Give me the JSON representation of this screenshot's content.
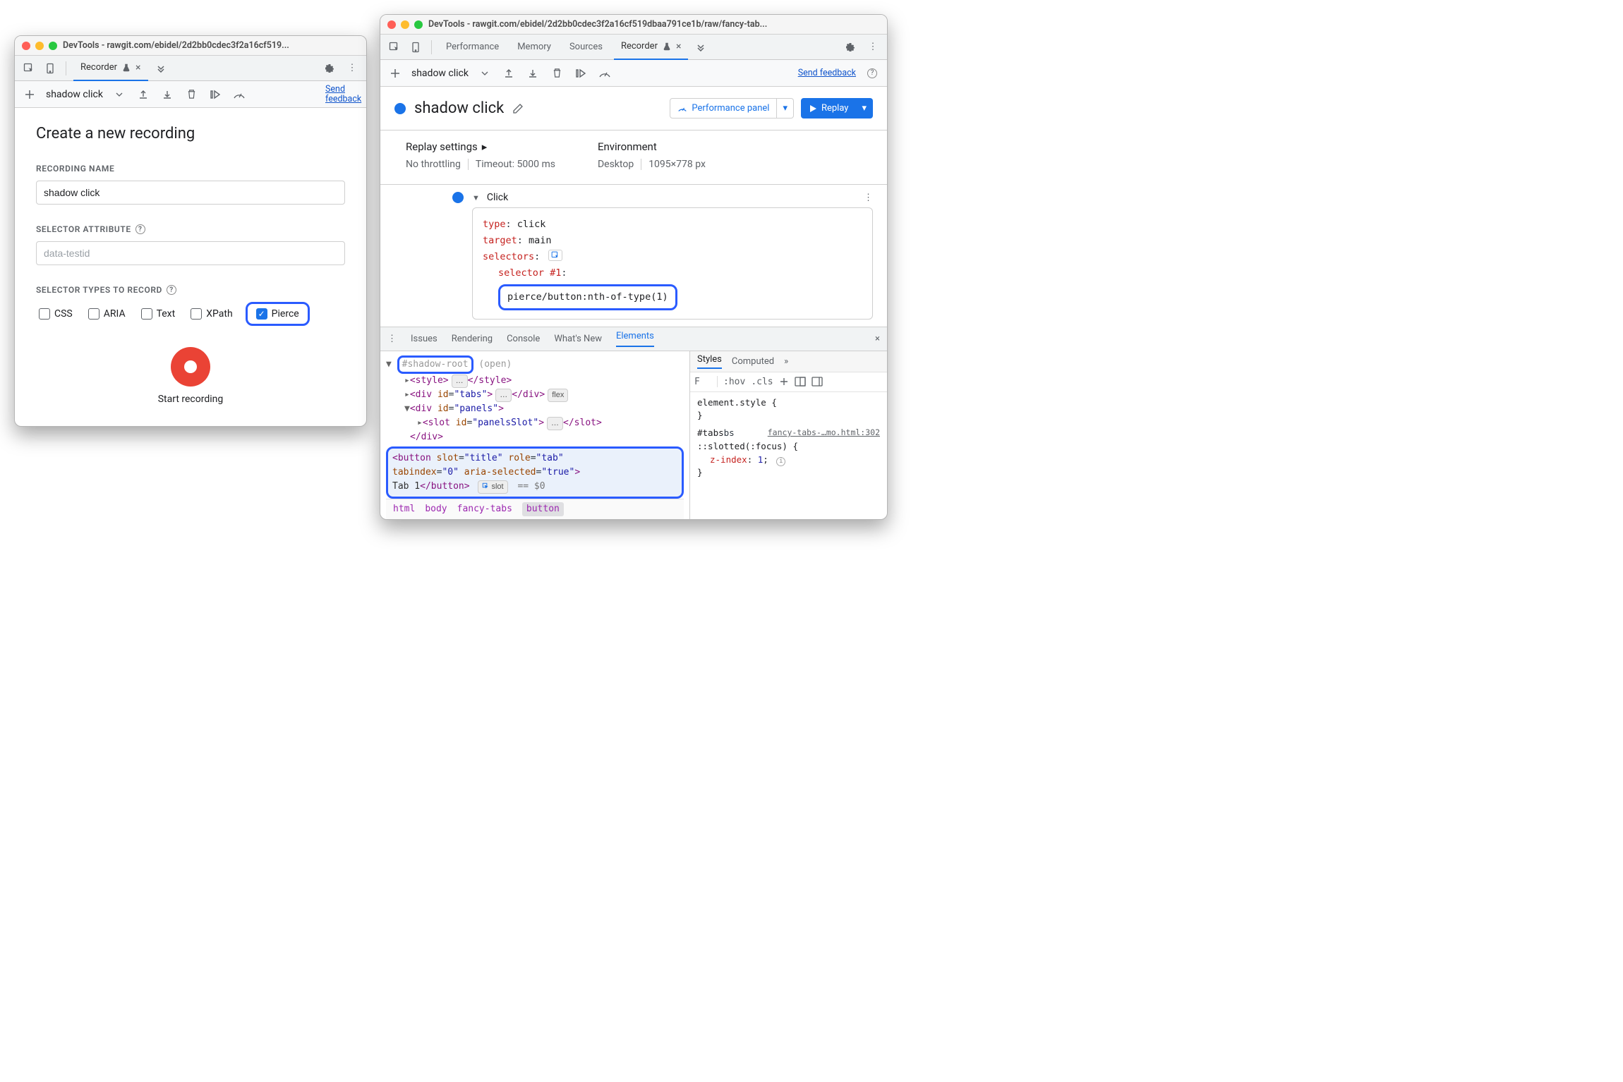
{
  "left": {
    "title": "DevTools - rawgit.com/ebidel/2d2bb0cdec3f2a16cf519...",
    "tab": "Recorder",
    "toolbar": {
      "name": "shadow click",
      "send_feedback": "Send feedback"
    },
    "heading": "Create a new recording",
    "recording_name_label": "RECORDING NAME",
    "recording_name_value": "shadow click",
    "selector_attr_label": "SELECTOR ATTRIBUTE",
    "selector_attr_placeholder": "data-testid",
    "selector_types_label": "SELECTOR TYPES TO RECORD",
    "types": {
      "css": "CSS",
      "aria": "ARIA",
      "text": "Text",
      "xpath": "XPath",
      "pierce": "Pierce"
    },
    "start_label": "Start recording"
  },
  "right": {
    "title": "DevTools - rawgit.com/ebidel/2d2bb0cdec3f2a16cf519dbaa791ce1b/raw/fancy-tab...",
    "tabs": {
      "performance": "Performance",
      "memory": "Memory",
      "sources": "Sources",
      "recorder": "Recorder"
    },
    "toolbar": {
      "name": "shadow click",
      "send_feedback": "Send feedback"
    },
    "header": {
      "title": "shadow click",
      "perf_panel": "Performance panel",
      "replay": "Replay"
    },
    "settings": {
      "replay_label": "Replay settings",
      "throttling": "No throttling",
      "timeout": "Timeout: 5000 ms",
      "env_label": "Environment",
      "env_device": "Desktop",
      "env_size": "1095×778 px"
    },
    "step": {
      "title": "Click",
      "type_k": "type",
      "type_v": "click",
      "target_k": "target",
      "target_v": "main",
      "selectors_k": "selectors",
      "selector_k": "selector #1",
      "selector_v": "pierce/button:nth-of-type(1)"
    },
    "drawer_tabs": {
      "issues": "Issues",
      "rendering": "Rendering",
      "console": "Console",
      "whatsnew": "What's New",
      "elements": "Elements"
    },
    "dom": {
      "shadow_root": "#shadow-root",
      "open": "(open)",
      "style_open": "<style>",
      "style_close": "</style>",
      "dots": "…",
      "tabs_open": "<div id=\"tabs\">",
      "tabs_close": "</div>",
      "flex_badge": "flex",
      "panels_open": "<div id=\"panels\">",
      "slot_open": "<slot id=\"panelsSlot\">",
      "slot_close": "</slot>",
      "div_close": "</div>",
      "button_l1": "<button slot=\"title\" role=\"tab\"",
      "button_l2": "tabindex=\"0\" aria-selected=\"true\">",
      "button_text": "Tab 1",
      "button_close": "</button>",
      "slot_badge": "slot",
      "eq0": "== $0"
    },
    "crumbs": [
      "html",
      "body",
      "fancy-tabs",
      "button"
    ],
    "styles": {
      "tab_styles": "Styles",
      "tab_computed": "Computed",
      "filter": "F",
      "hov": ":hov",
      "cls": ".cls",
      "rule1": "element.style {",
      "brace": "}",
      "rule2_sel": "#tabs",
      "rule2_src": "fancy-tabs-…mo.html:302",
      "rule3_sel": "::slotted(:focus) {",
      "prop_name": "z-index",
      "prop_val": "1"
    }
  }
}
